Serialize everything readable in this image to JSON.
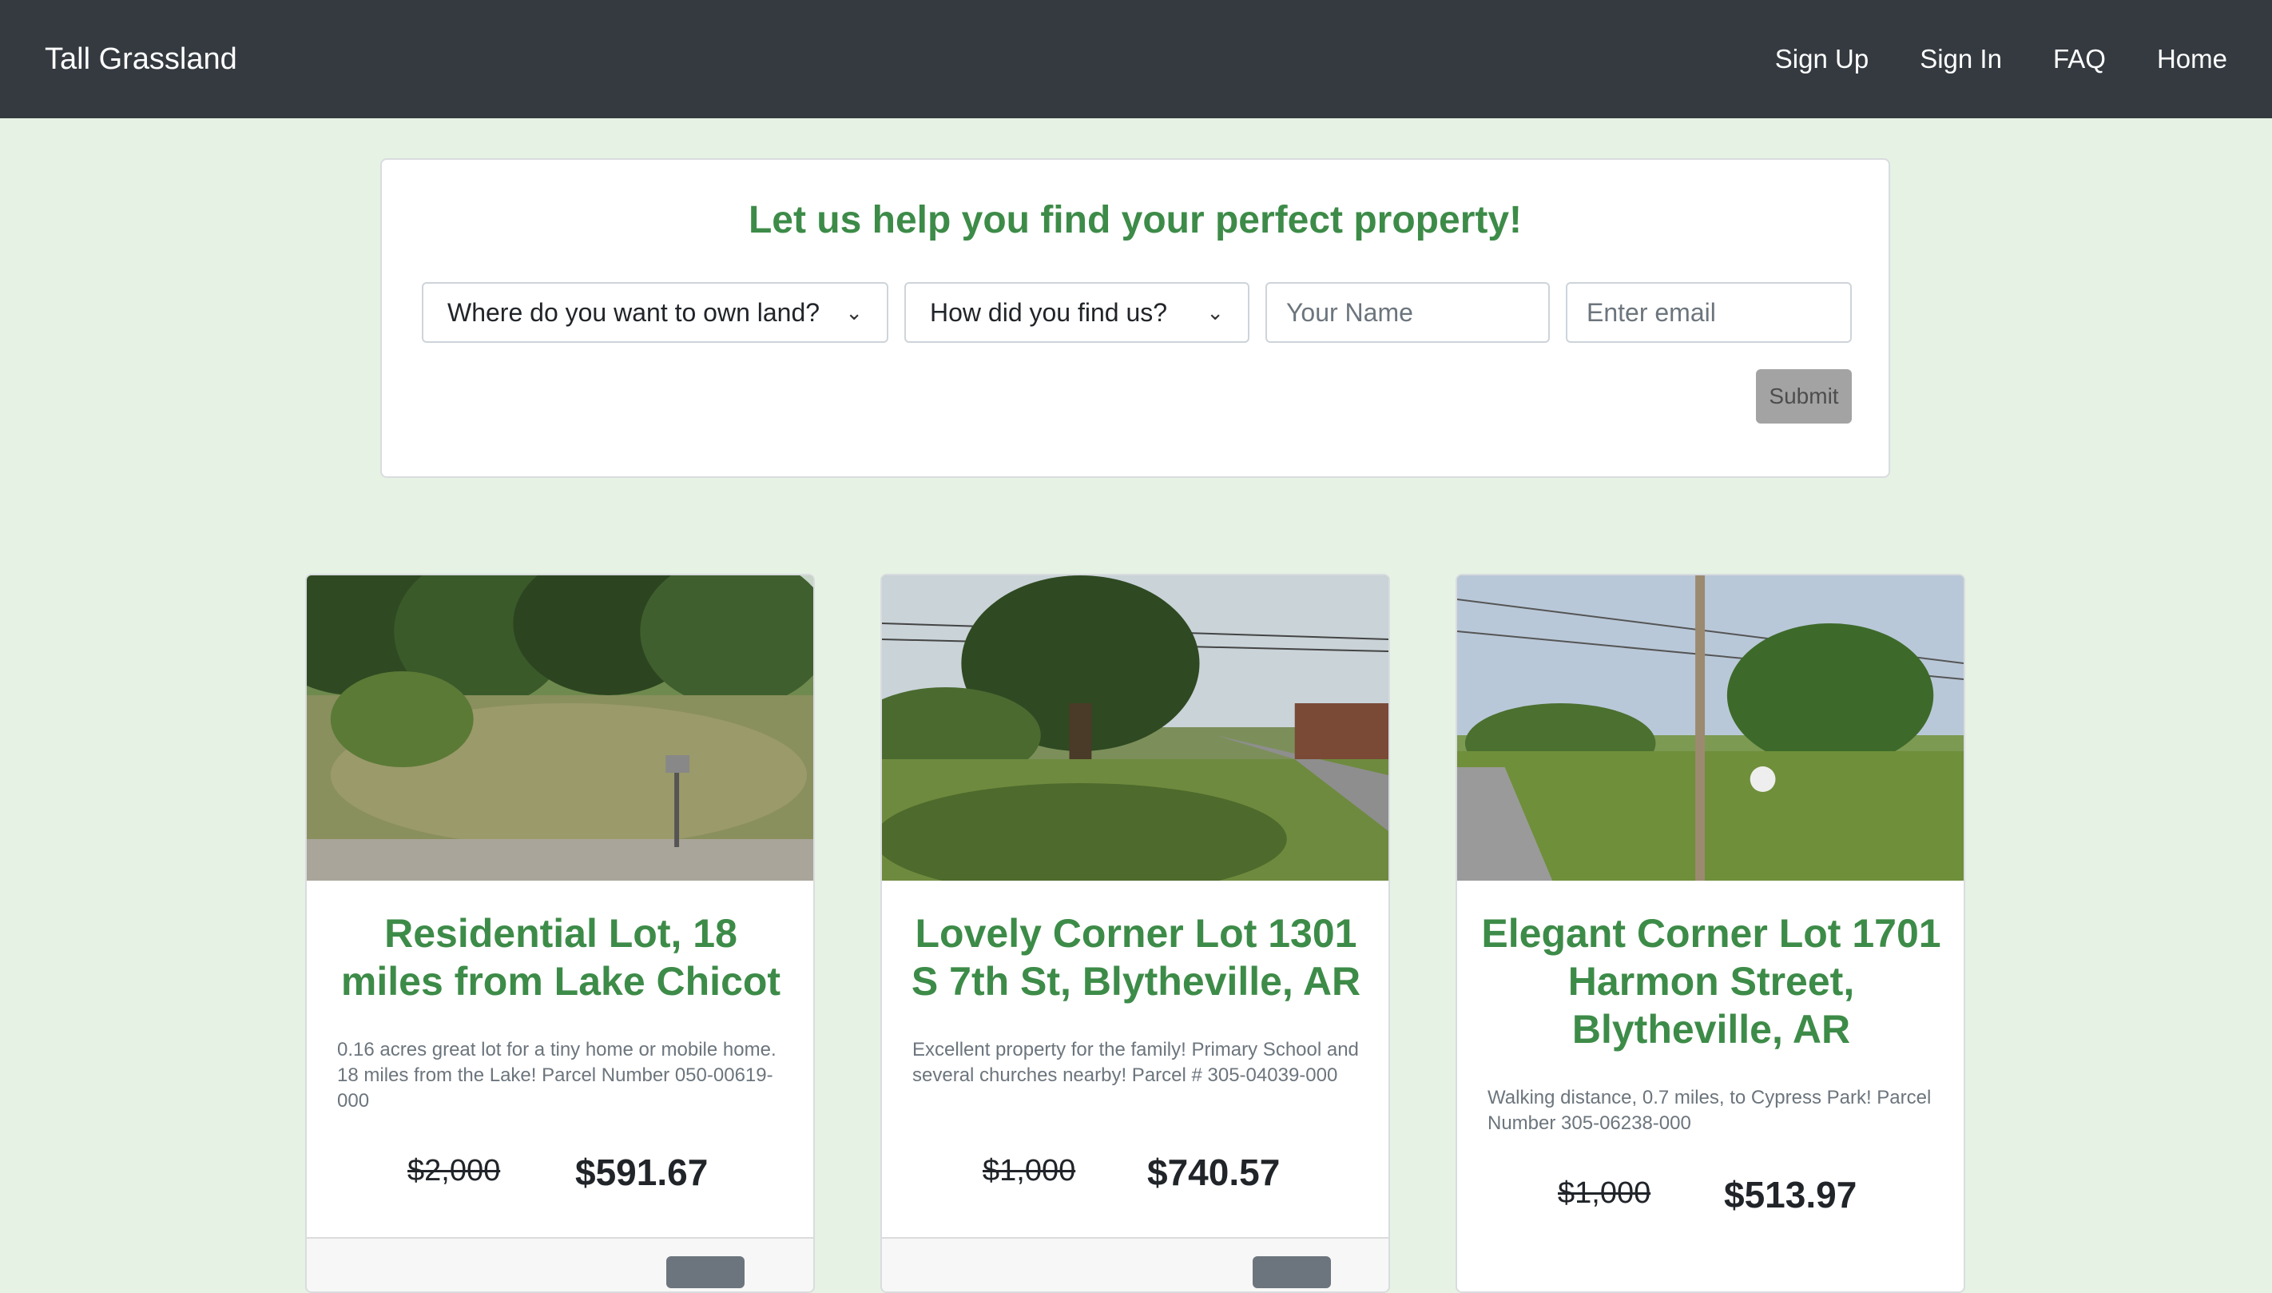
{
  "navbar": {
    "brand": "Tall Grassland",
    "links": [
      "Sign Up",
      "Sign In",
      "FAQ",
      "Home"
    ]
  },
  "form": {
    "heading": "Let us help you find your perfect property!",
    "location_select": "Where do you want to own land?",
    "source_select": "How did you find us?",
    "name_placeholder": "Your Name",
    "email_placeholder": "Enter email",
    "submit_label": "Submit"
  },
  "listings": [
    {
      "title": "Residential Lot, 18 miles from Lake Chicot",
      "description": "0.16 acres great lot for a tiny home or mobile home. 18 miles from the Lake! Parcel Number 050-00619-000",
      "old_price": "$2,000",
      "price": "$591.67"
    },
    {
      "title": "Lovely Corner Lot 1301 S 7th St, Blytheville, AR",
      "description": "Excellent property for the family! Primary School and several churches nearby! Parcel # 305-04039-000",
      "old_price": "$1,000",
      "price": "$740.57"
    },
    {
      "title": "Elegant Corner Lot 1701 Harmon Street, Blytheville, AR",
      "description": "Walking distance, 0.7 miles, to Cypress Park! Parcel Number 305-06238-000",
      "old_price": "$1,000",
      "price": "$513.97"
    }
  ],
  "colors": {
    "navbar_bg": "#343a40",
    "page_bg": "#e6f2e4",
    "accent_green": "#3d8b48"
  }
}
